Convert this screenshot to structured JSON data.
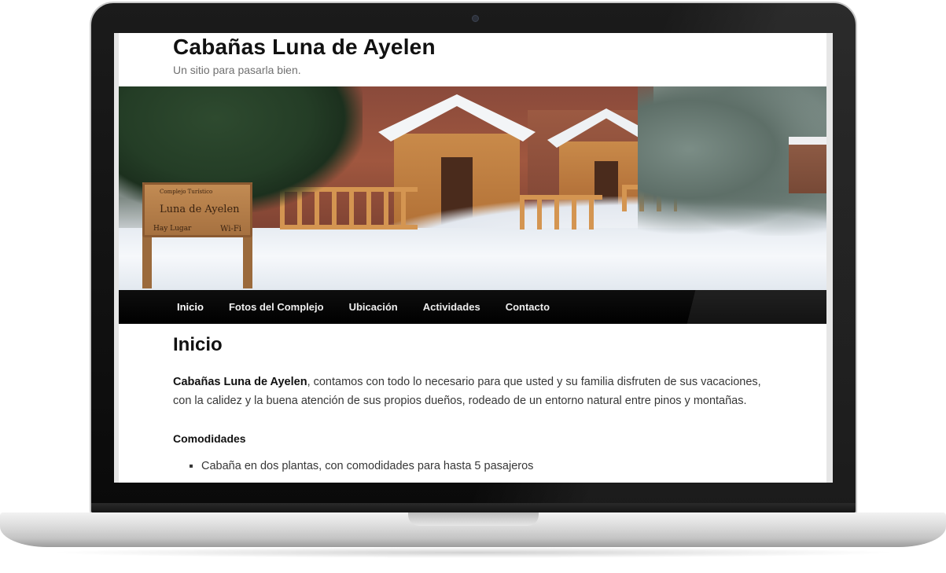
{
  "site": {
    "title": "Cabañas Luna de Ayelen",
    "description": "Un sitio para pasarla bien."
  },
  "hero": {
    "sign_top": "Complejo Turístico",
    "sign_main": "Luna de Ayelen",
    "sign_left": "Hay Lugar",
    "sign_right": "Wi-Fi"
  },
  "nav": {
    "items": [
      {
        "label": "Inicio",
        "active": true
      },
      {
        "label": "Fotos del Complejo",
        "active": false
      },
      {
        "label": "Ubicación",
        "active": false
      },
      {
        "label": "Actividades",
        "active": false
      },
      {
        "label": "Contacto",
        "active": false
      }
    ]
  },
  "content": {
    "page_title": "Inicio",
    "lead_strong": "Cabañas Luna de Ayelen",
    "lead_text": ",  contamos con todo lo necesario para que usted y su familia disfruten de sus vacaciones, con la calidez y la buena atención de sus propios dueños, rodeado de un entorno natural entre pinos y montañas.",
    "features_title": "Comodidades",
    "features": [
      "Cabaña en dos plantas, con comodidades para hasta 5 pasajeros"
    ]
  },
  "colors": {
    "nav_background": "#000000",
    "title_text": "#111111",
    "body_text": "#373737",
    "description_text": "#707070"
  }
}
